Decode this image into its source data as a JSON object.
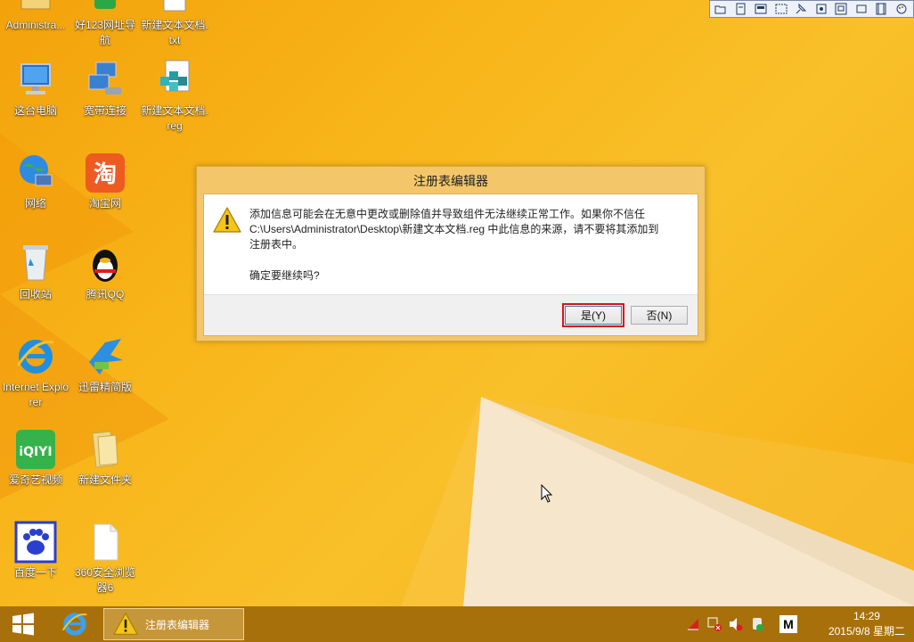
{
  "desktop": {
    "icons": [
      {
        "label": "Administra..."
      },
      {
        "label": "好123网址导航"
      },
      {
        "label": "新建文本文档.txt"
      },
      {
        "label": "这台电脑"
      },
      {
        "label": "宽带连接"
      },
      {
        "label": "新建文本文档.reg"
      },
      {
        "label": "网络"
      },
      {
        "label": "淘宝网"
      },
      {
        "label": "回收站"
      },
      {
        "label": "腾讯QQ"
      },
      {
        "label": "Internet Explorer"
      },
      {
        "label": "迅雷精简版"
      },
      {
        "label": "爱奇艺视频"
      },
      {
        "label": "新建文件夹"
      },
      {
        "label": "百度一下"
      },
      {
        "label": "360安全浏览器6"
      }
    ]
  },
  "dialog": {
    "title": "注册表编辑器",
    "line1": "添加信息可能会在无意中更改或删除值并导致组件无法继续正常工作。如果你不信任",
    "line2": "C:\\Users\\Administrator\\Desktop\\新建文本文档.reg 中此信息的来源，请不要将其添加到",
    "line3": "注册表中。",
    "confirm": "确定要继续吗?",
    "yes_label": "是(Y)",
    "no_label": "否(N)"
  },
  "taskbar": {
    "task_title": "注册表编辑器",
    "ime": "M",
    "time": "14:29",
    "date": "2015/9/8 星期二"
  },
  "colors": {
    "wallpaper": "#f6b10d",
    "taskbar": "#a8700a",
    "dialog_frame": "#f4c66a",
    "button_focus_outline": "#d4141e"
  }
}
